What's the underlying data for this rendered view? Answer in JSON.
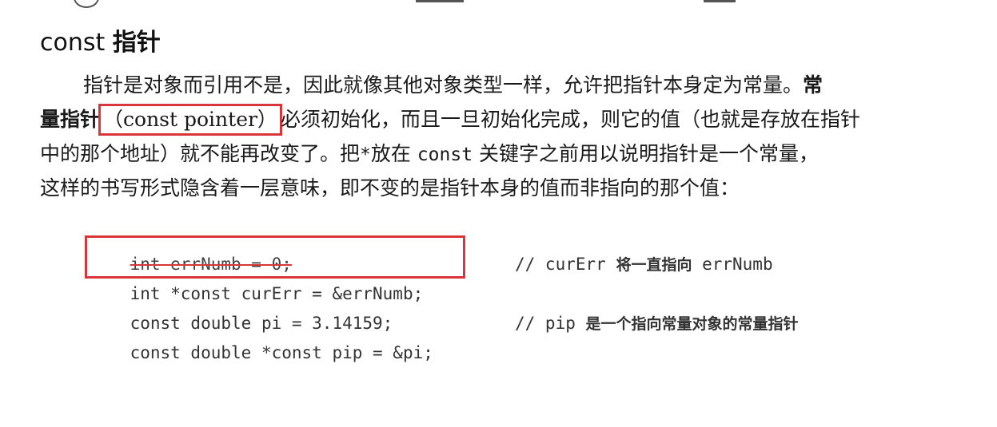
{
  "heading": {
    "latin": "const ",
    "chinese": "指针"
  },
  "paragraph": {
    "line1_a": "指针是对象而引用不是，因此就像其他对象类型一样，允许把指针本身定为常量。",
    "line1_b": "常",
    "line2_a": "量指针",
    "line2_boxed": "（const pointer）",
    "line2_b": "必须初始化，而且一旦初始化完成，则它的值（也就是存放在指针",
    "line3_a": "中的那个地址）就不能再改变了。把",
    "line3_code1": "*",
    "line3_b": "放在 ",
    "line3_code2": "const",
    "line3_c": " 关键字之前用以说明指针是一个常量，",
    "line4": "这样的书写形式隐含着一层意味，即不变的是指针本身的值而非指向的那个值："
  },
  "code": [
    {
      "text": "int errNumb = 0;",
      "comment_code": "",
      "comment_zh": "",
      "comment_tail": ""
    },
    {
      "text": "int *const curErr = &errNumb;",
      "comment_code": "// curErr ",
      "comment_zh": "将一直指向",
      "comment_tail": " errNumb"
    },
    {
      "text": "const double pi = 3.14159;",
      "comment_code": "",
      "comment_zh": "",
      "comment_tail": ""
    },
    {
      "text": "const double *const pip = &pi;",
      "comment_code": "// pip ",
      "comment_zh": "是一个指向常量对象的常量指针",
      "comment_tail": ""
    }
  ],
  "colors": {
    "highlight_box": "#d8363a",
    "text": "#1a1a1a"
  }
}
